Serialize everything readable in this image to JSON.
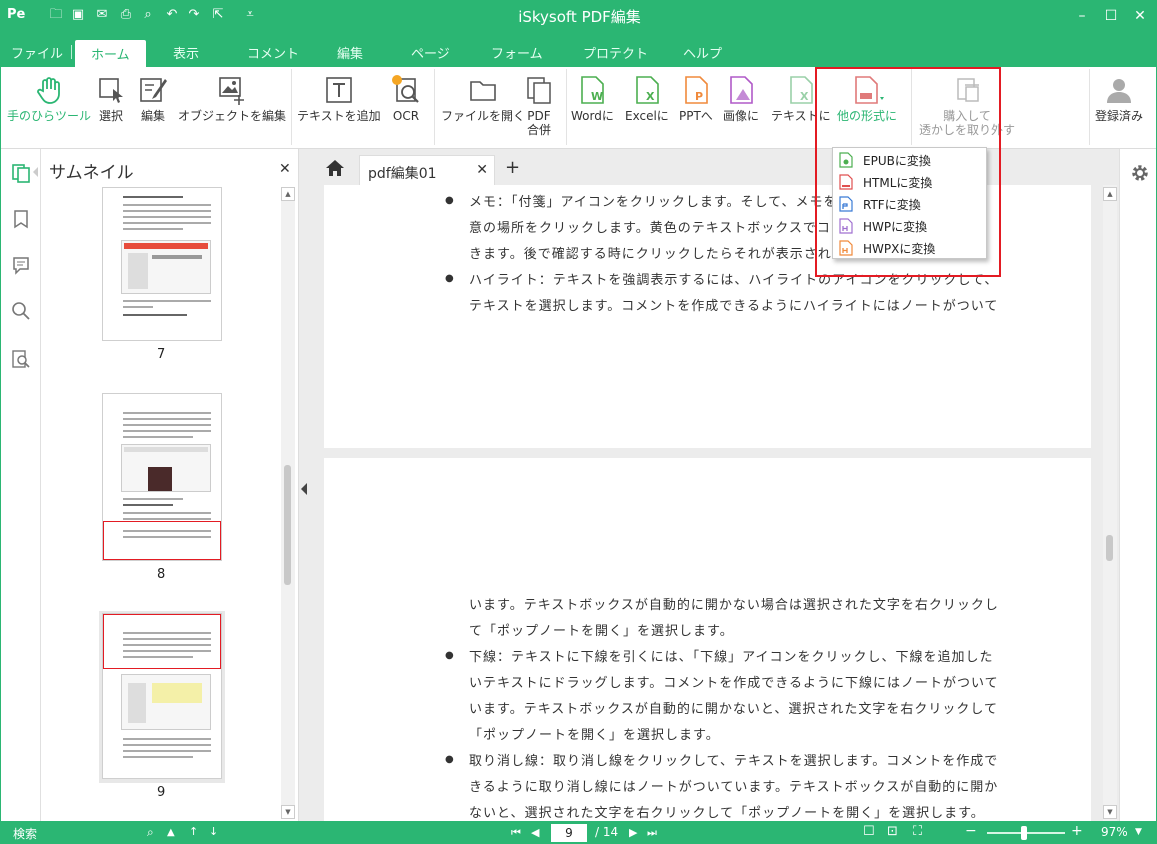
{
  "app": {
    "logo": "Pe",
    "title": "iSkysoft PDF編集"
  },
  "menu": {
    "tabs": [
      "ファイル",
      "ホーム",
      "表示",
      "コメント",
      "編集",
      "ページ",
      "フォーム",
      "プロテクト",
      "ヘルプ"
    ],
    "active": "ホーム"
  },
  "ribbon": {
    "hand": "手のひらツール",
    "select": "選択",
    "edit": "編集",
    "edit_object": "オブジェクトを編集",
    "add_text": "テキストを追加",
    "ocr": "OCR",
    "open_file": "ファイルを開く",
    "pdf_merge_1": "PDF",
    "pdf_merge_2": "合併",
    "to_word": "Wordに",
    "to_excel": "Excelに",
    "to_ppt": "PPTへ",
    "to_image": "画像に",
    "to_text": "テキストに",
    "to_other": "他の形式に",
    "purchase_1": "購入して",
    "purchase_2": "透かしを取り外す",
    "registered": "登録済み"
  },
  "dropdown": {
    "items": [
      "EPUBに変換",
      "HTMLに変換",
      "RTFに変換",
      "HWPに変換",
      "HWPXに変換"
    ]
  },
  "thumbnails": {
    "title": "サムネイル",
    "pages": [
      "7",
      "8",
      "9"
    ]
  },
  "document": {
    "tab": "pdf編集01",
    "page1_lines": [
      "メモ：「付箋」アイコンをクリックします。そして、メモを",
      "意の場所をクリックします。黄色のテキストボックスでコメ",
      "きます。後で確認する時にクリックしたらそれが表示されま",
      "ハイライト：テキストを強調表示するには、ハイライトのアイコンをクリックして、",
      "テキストを選択します。コメントを作成できるようにハイライトにはノートがついて"
    ],
    "page2_lines": [
      "います。テキストボックスが自動的に開かない場合は選択された文字を右クリックし",
      "て「ポップノートを開く」を選択します。",
      "下線：テキストに下線を引くには、「下線」アイコンをクリックし、下線を追加した",
      "いテキストにドラッグします。コメントを作成できるように下線にはノートがついて",
      "います。テキストボックスが自動的に開かないと、選択された文字を右クリックして",
      "「ポップノートを開く」を選択します。",
      "取り消し線：取り消し線をクリックして、テキストを選択します。コメントを作成で",
      "きるように取り消し線にはノートがついています。テキストボックスが自動的に開か",
      "ないと、選択された文字を右クリックして「ポップノートを開く」を選択します。"
    ]
  },
  "status": {
    "search": "検索",
    "page": "9",
    "total": "/ 14",
    "zoom": "97%"
  },
  "colors": {
    "brand": "#2bb673",
    "highlight": "#e31b23"
  }
}
